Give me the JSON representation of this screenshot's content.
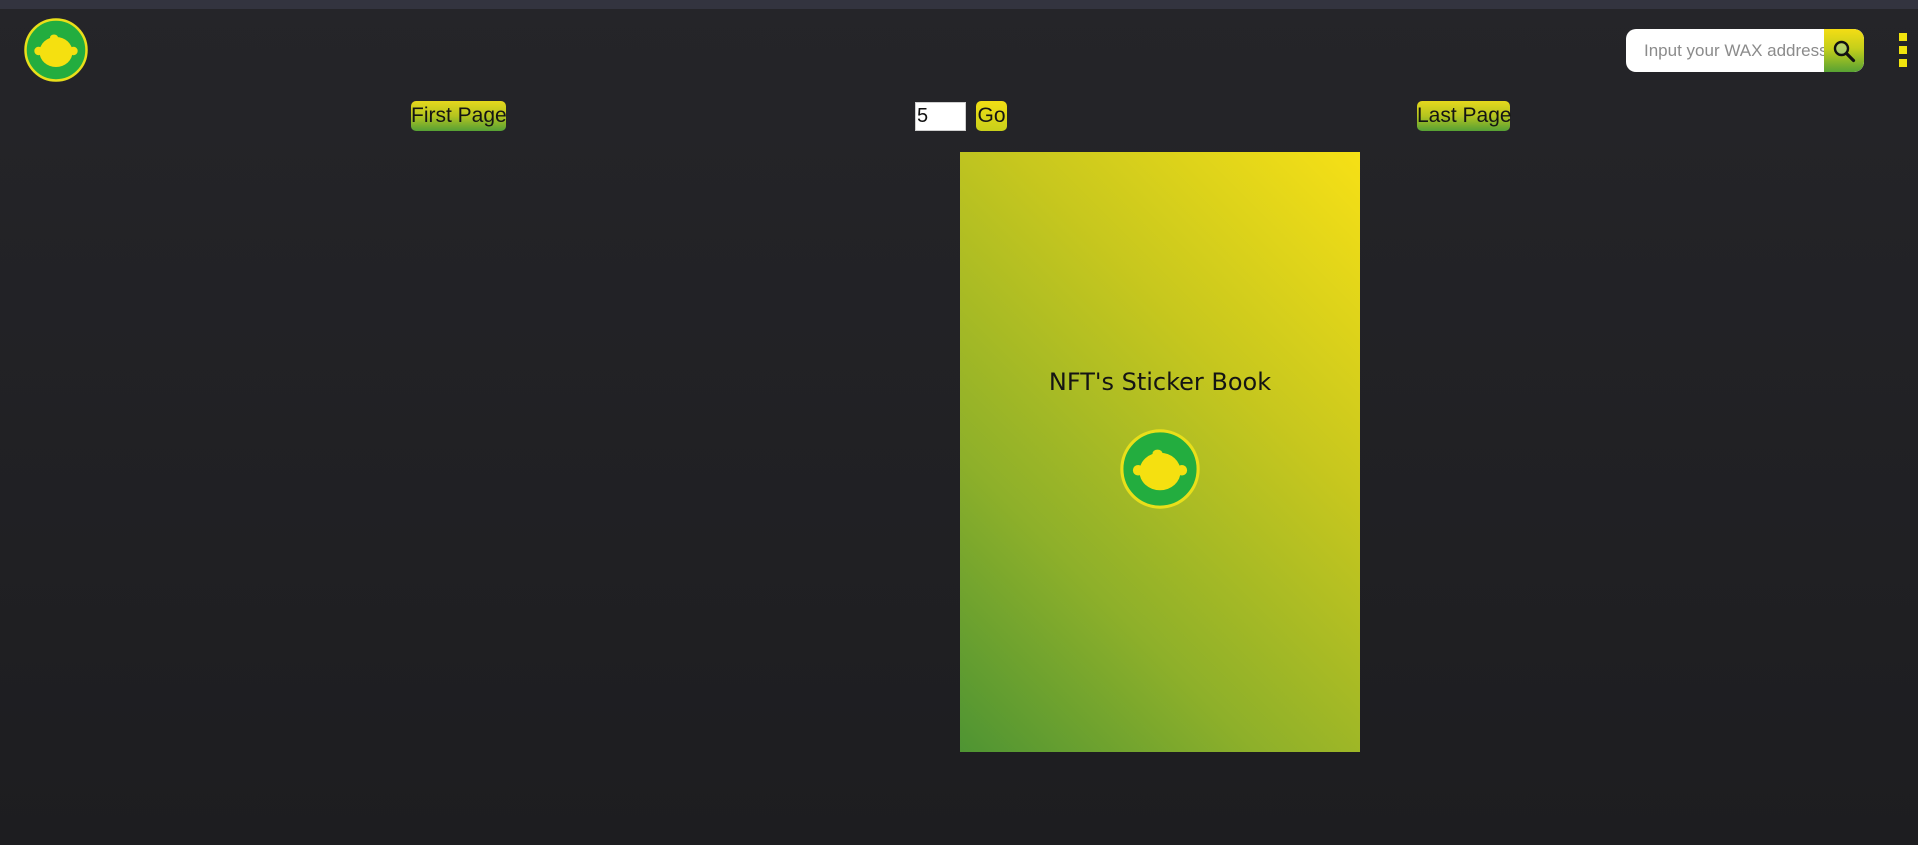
{
  "header": {
    "logo_icon": "monkey-head-logo-icon",
    "search": {
      "placeholder": "Input your WAX address (",
      "value": "",
      "button_icon": "search-icon"
    },
    "menu_icon": "kebab-menu-icon"
  },
  "pagination": {
    "first_label": "First Page",
    "page_value": "5",
    "go_label": "Go",
    "last_label": "Last Page"
  },
  "book": {
    "title": "NFT's Sticker Book",
    "logo_icon": "monkey-head-logo-icon"
  },
  "colors": {
    "background": "#1f1f22",
    "logo_green": "#22ae3e",
    "accent_yellow": "#f4e016",
    "accent_green": "#58a233"
  }
}
